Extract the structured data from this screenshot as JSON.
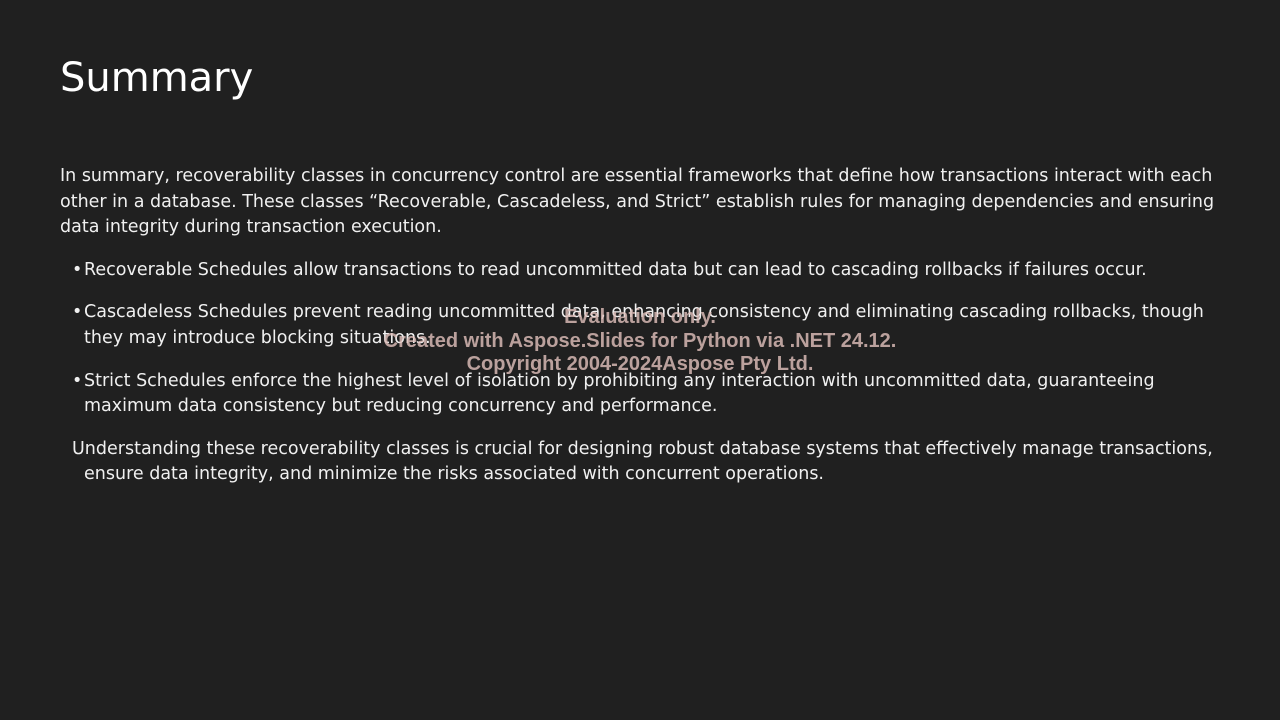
{
  "slide": {
    "title": "Summary",
    "intro": "In summary, recoverability classes in concurrency control are essential frameworks that define how transactions interact with each other in a database. These classes “Recoverable, Cascadeless, and Strict” establish rules for managing dependencies and ensuring data integrity during transaction execution.",
    "bullet_marker": "•",
    "bullets": [
      "Recoverable Schedules allow transactions to read uncommitted data but can lead to cascading rollbacks if failures occur.",
      "Cascadeless Schedules prevent reading uncommitted data, enhancing consistency and eliminating cascading rollbacks, though they may introduce blocking situations.",
      "Strict Schedules enforce the highest level of isolation by prohibiting any interaction with uncommitted data, guaranteeing maximum data consistency but reducing concurrency and performance."
    ],
    "closing": "Understanding these recoverability classes is crucial for designing robust database systems that effectively manage transactions, ensure data integrity, and minimize the risks associated with concurrent operations."
  },
  "watermark": {
    "line1": "Evaluation only.",
    "line2": "Created with Aspose.Slides for Python via .NET 24.12.",
    "line3": "Copyright 2004-2024Aspose Pty Ltd."
  },
  "colors": {
    "background": "#202020",
    "text": "#f0f0f0",
    "watermark": "#debeb9"
  }
}
